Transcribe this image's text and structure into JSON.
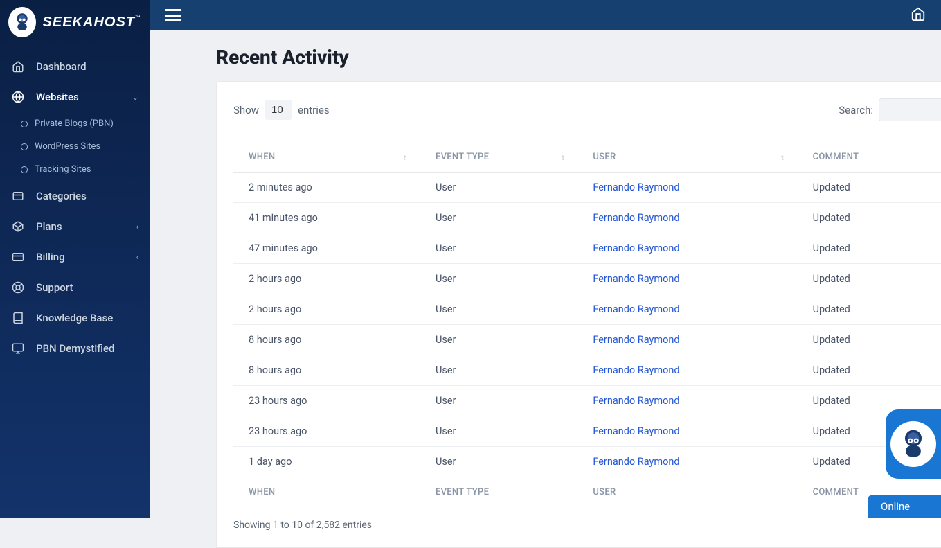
{
  "brand": {
    "name": "SEEKAHOST",
    "tm": "™"
  },
  "sidebar": {
    "items": [
      {
        "label": "Dashboard"
      },
      {
        "label": "Websites",
        "expanded": true
      },
      {
        "label": "Categories"
      },
      {
        "label": "Plans"
      },
      {
        "label": "Billing"
      },
      {
        "label": "Support"
      },
      {
        "label": "Knowledge Base"
      },
      {
        "label": "PBN Demystified"
      }
    ],
    "websites_sub": [
      {
        "label": "Private Blogs (PBN)"
      },
      {
        "label": "WordPress Sites"
      },
      {
        "label": "Tracking Sites"
      }
    ]
  },
  "page": {
    "title": "Recent Activity"
  },
  "table": {
    "show_label": "Show",
    "entries_label": "entries",
    "page_size": "10",
    "search_label": "Search:",
    "search_value": "",
    "columns": {
      "when": "WHEN",
      "event_type": "EVENT TYPE",
      "user": "USER",
      "comment": "COMMENT"
    },
    "rows": [
      {
        "when": "2 minutes ago",
        "event_type": "User",
        "user": "Fernando Raymond",
        "comment": "Updated"
      },
      {
        "when": "41 minutes ago",
        "event_type": "User",
        "user": "Fernando Raymond",
        "comment": "Updated"
      },
      {
        "when": "47 minutes ago",
        "event_type": "User",
        "user": "Fernando Raymond",
        "comment": "Updated"
      },
      {
        "when": "2 hours ago",
        "event_type": "User",
        "user": "Fernando Raymond",
        "comment": "Updated"
      },
      {
        "when": "2 hours ago",
        "event_type": "User",
        "user": "Fernando Raymond",
        "comment": "Updated"
      },
      {
        "when": "8 hours ago",
        "event_type": "User",
        "user": "Fernando Raymond",
        "comment": "Updated"
      },
      {
        "when": "8 hours ago",
        "event_type": "User",
        "user": "Fernando Raymond",
        "comment": "Updated"
      },
      {
        "when": "23 hours ago",
        "event_type": "User",
        "user": "Fernando Raymond",
        "comment": "Updated"
      },
      {
        "when": "23 hours ago",
        "event_type": "User",
        "user": "Fernando Raymond",
        "comment": "Updated"
      },
      {
        "when": "1 day ago",
        "event_type": "User",
        "user": "Fernando Raymond",
        "comment": "Updated"
      }
    ],
    "info": "Showing 1 to 10 of 2,582 entries"
  },
  "chat": {
    "status": "Online"
  }
}
